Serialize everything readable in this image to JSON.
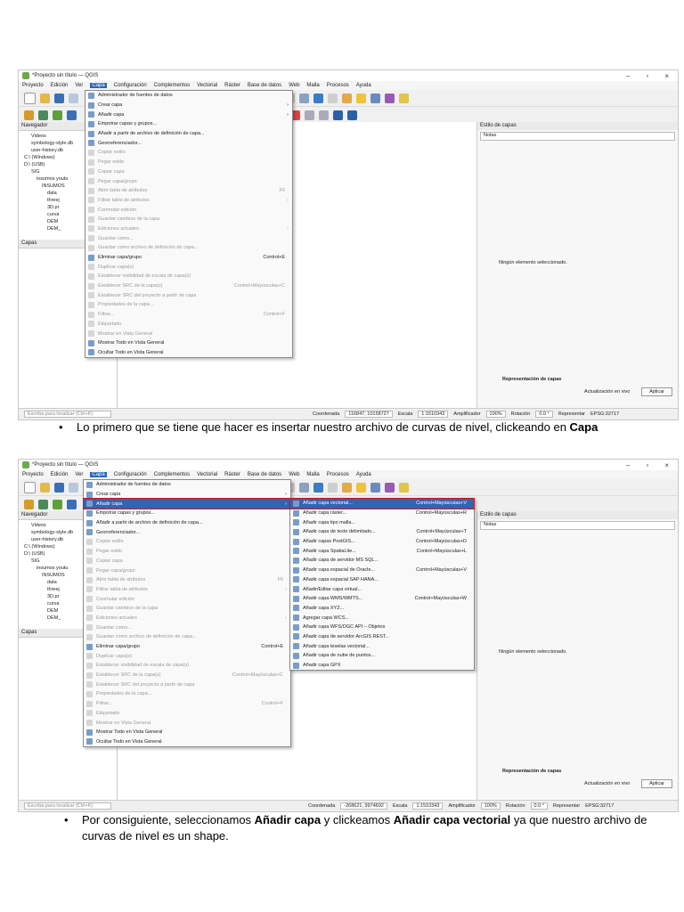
{
  "qgis": {
    "window_title": "*Proyecto sin título — QGIS",
    "menu": [
      "Proyecto",
      "Edición",
      "Ver",
      "Capa",
      "Configuración",
      "Complementos",
      "Vectorial",
      "Ráster",
      "Base de datos",
      "Web",
      "Malla",
      "Procesos",
      "Ayuda"
    ],
    "navigator_title": "Navegador",
    "layers_title": "Capas",
    "browser_tree": [
      "Videos",
      "symbology-style.db",
      "user-history.db",
      "C:\\ (Windows)",
      "D:\\ (USB)",
      "SIG",
      "insumos youtu",
      "INSUMOS",
      "data",
      "threej",
      "3D.pr",
      "curva",
      "DEM",
      "DEM_"
    ],
    "style_panel_title": "Estilo de capas",
    "style_notes": "Notas",
    "no_layer_selected": "Ningún elemento seleccionado.",
    "layer_rendering": "Representación de capas",
    "live_update": "Actualización en vivo",
    "apply": "Aplicar",
    "locator_placeholder": "Escriba para localizar (Ctrl+K)",
    "coordinate_label": "Coordenada",
    "scale_label": "Escala",
    "scale_value": "1:1510343",
    "magnifier_label": "Amplificador",
    "magnifier_value": "100%",
    "rotation_label": "Rotación",
    "rotation_value": "0.0 °",
    "render_label": "Representar",
    "crs": "EPSG:32717"
  },
  "layer_menu": [
    {
      "label": "Administrador de fuentes de datos",
      "shortcut": "",
      "disabled": false,
      "submenu": false
    },
    {
      "label": "Crear capa",
      "shortcut": "",
      "disabled": false,
      "submenu": true
    },
    {
      "label": "Añadir capa",
      "shortcut": "",
      "disabled": false,
      "submenu": true
    },
    {
      "label": "Empotrar capas y grupos...",
      "shortcut": "",
      "disabled": false,
      "submenu": false
    },
    {
      "label": "Añadir a partir de archivo de definición de capa...",
      "shortcut": "",
      "disabled": false,
      "submenu": false
    },
    {
      "label": "Georreferenciador...",
      "shortcut": "",
      "disabled": false,
      "submenu": false
    },
    {
      "label": "Copiar estilo",
      "shortcut": "",
      "disabled": true,
      "submenu": false
    },
    {
      "label": "Pegar estilo",
      "shortcut": "",
      "disabled": true,
      "submenu": false
    },
    {
      "label": "Copiar capa",
      "shortcut": "",
      "disabled": true,
      "submenu": false
    },
    {
      "label": "Pegar capa/grupo",
      "shortcut": "",
      "disabled": true,
      "submenu": false
    },
    {
      "label": "Abrir tabla de atributos",
      "shortcut": "F6",
      "disabled": true,
      "submenu": false
    },
    {
      "label": "Filtrar tabla de atributos",
      "shortcut": "",
      "disabled": true,
      "submenu": true
    },
    {
      "label": "Conmutar edición",
      "shortcut": "",
      "disabled": true,
      "submenu": false
    },
    {
      "label": "Guardar cambios de la capa",
      "shortcut": "",
      "disabled": true,
      "submenu": false
    },
    {
      "label": "Ediciones actuales",
      "shortcut": "",
      "disabled": true,
      "submenu": true
    },
    {
      "label": "Guardar como...",
      "shortcut": "",
      "disabled": true,
      "submenu": false
    },
    {
      "label": "Guardar como archivo de definición de capa...",
      "shortcut": "",
      "disabled": true,
      "submenu": false
    },
    {
      "label": "Eliminar capa/grupo",
      "shortcut": "Control+E",
      "disabled": false,
      "submenu": false
    },
    {
      "label": "Duplicar capa(s)",
      "shortcut": "",
      "disabled": true,
      "submenu": false
    },
    {
      "label": "Establecer visibilidad de escala de capa(s)",
      "shortcut": "",
      "disabled": true,
      "submenu": false
    },
    {
      "label": "Establecer SRC de la capa(s)",
      "shortcut": "Control+Mayúsculas+C",
      "disabled": true,
      "submenu": false
    },
    {
      "label": "Establecer SRC del proyecto a partir de capa",
      "shortcut": "",
      "disabled": true,
      "submenu": false
    },
    {
      "label": "Propiedades de la capa...",
      "shortcut": "",
      "disabled": true,
      "submenu": false
    },
    {
      "label": "Filtrar...",
      "shortcut": "Control+F",
      "disabled": true,
      "submenu": false
    },
    {
      "label": "Etiquetado",
      "shortcut": "",
      "disabled": true,
      "submenu": false
    },
    {
      "label": "Mostrar en Vista General",
      "shortcut": "",
      "disabled": true,
      "submenu": false
    },
    {
      "label": "Mostrar Todo en Vista General",
      "shortcut": "",
      "disabled": false,
      "submenu": false
    },
    {
      "label": "Ocultar Todo en Vista General",
      "shortcut": "",
      "disabled": false,
      "submenu": false
    }
  ],
  "add_layer_submenu": [
    {
      "label": "Añadir capa vectorial...",
      "shortcut": "Control+Mayúsculas+V"
    },
    {
      "label": "Añadir capa ráster...",
      "shortcut": "Control+Mayúsculas+R"
    },
    {
      "label": "Añadir capa tipo malla...",
      "shortcut": ""
    },
    {
      "label": "Añadir capa de texto delimitado...",
      "shortcut": "Control+Mayúsculas+T"
    },
    {
      "label": "Añadir capas PostGIS...",
      "shortcut": "Control+Mayúsculas+D"
    },
    {
      "label": "Añadir capa SpatiaLite...",
      "shortcut": "Control+Mayúsculas+L"
    },
    {
      "label": "Añadir capa de servidor MS SQL...",
      "shortcut": ""
    },
    {
      "label": "Añadir capa espacial de Oracle...",
      "shortcut": "Control+Mayúsculas+V"
    },
    {
      "label": "Añadir capa espacial SAP HANA...",
      "shortcut": ""
    },
    {
      "label": "Añadir/Editar capa virtual...",
      "shortcut": ""
    },
    {
      "label": "Añadir capa WMS/WMTS...",
      "shortcut": "Control+Mayúsculas+W"
    },
    {
      "label": "Añadir capa XYZ...",
      "shortcut": ""
    },
    {
      "label": "Agregar capa WCS...",
      "shortcut": ""
    },
    {
      "label": "Añadir capa WFS/OGC API – Objetos",
      "shortcut": ""
    },
    {
      "label": "Añadir capa de servidor ArcGIS REST...",
      "shortcut": ""
    },
    {
      "label": "Añadir capa teselas vectorial...",
      "shortcut": ""
    },
    {
      "label": "Añadir capa de nube de puntos...",
      "shortcut": ""
    },
    {
      "label": "Añadir capa GPX",
      "shortcut": ""
    }
  ],
  "shot1": {
    "coordinate_value": "116847, 10158727"
  },
  "shot2": {
    "coordinate_value": "-268621, 9974692"
  },
  "caption1": {
    "text": "Lo primero que se tiene que hacer es insertar nuestro archivo de curvas de nivel, clickeando en ",
    "bold": "Capa"
  },
  "caption2": {
    "text1": "Por consiguiente, seleccionamos ",
    "bold1": "Añadir capa",
    "text2": " y clickeamos ",
    "bold2": "Añadir capa vectorial",
    "text3": " ya que nuestro archivo de curvas de nivel es un shape."
  },
  "colors": {
    "selection": "#2d66b5",
    "highlight_border": "#dd1111",
    "qgis_green": "#6fa84a"
  }
}
